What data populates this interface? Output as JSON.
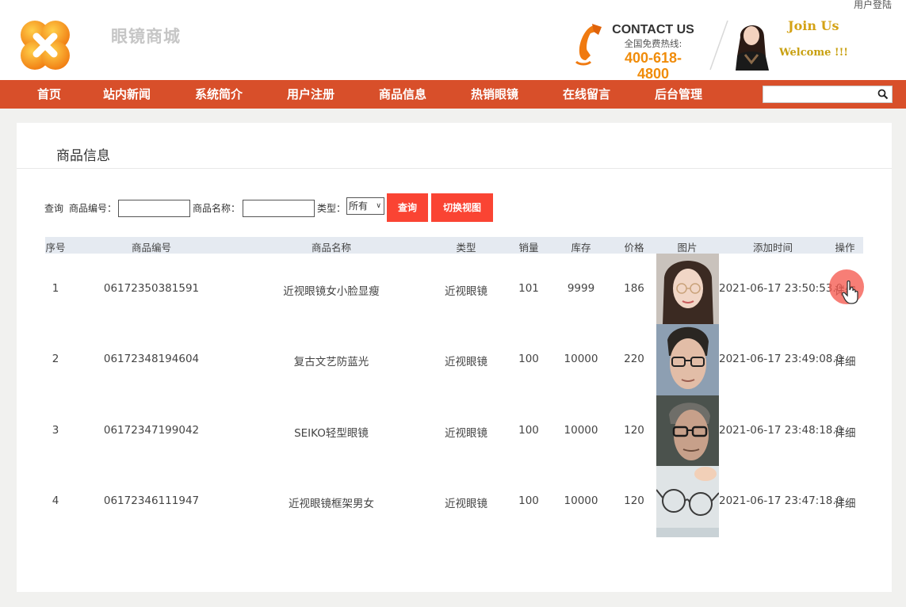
{
  "header": {
    "user_login": "用户登陆",
    "site_name": "眼镜商城",
    "contact_title": "CONTACT US",
    "contact_sub": "全国免费热线:",
    "contact_phone": "400-618-4800",
    "join": "Join Us",
    "welcome": "Welcome !!!"
  },
  "nav": {
    "items": [
      "首页",
      "站内新闻",
      "系统简介",
      "用户注册",
      "商品信息",
      "热销眼镜",
      "在线留言",
      "后台管理"
    ],
    "search_placeholder": ""
  },
  "panel": {
    "title": "商品信息"
  },
  "filter": {
    "query_label": "查询",
    "code_label": "商品编号：",
    "name_label": "商品名称：",
    "type_label": "类型：",
    "type_value": "所有",
    "query_button": "查询",
    "switch_button": "切换视图"
  },
  "table": {
    "headers": [
      "序号",
      "商品编号",
      "商品名称",
      "类型",
      "销量",
      "库存",
      "价格",
      "图片",
      "添加时间",
      "操作"
    ],
    "rows": [
      {
        "no": "1",
        "code": "06172350381591",
        "name": "近视眼镜女小脸显瘦",
        "type": "近视眼镜",
        "sales": "101",
        "stock": "9999",
        "price": "186",
        "time": "2021-06-17 23:50:53.0",
        "action": "详细"
      },
      {
        "no": "2",
        "code": "06172348194604",
        "name": "复古文艺防蓝光",
        "type": "近视眼镜",
        "sales": "100",
        "stock": "10000",
        "price": "220",
        "time": "2021-06-17 23:49:08.0",
        "action": "详细"
      },
      {
        "no": "3",
        "code": "06172347199042",
        "name": "SEIKO轻型眼镜",
        "type": "近视眼镜",
        "sales": "100",
        "stock": "10000",
        "price": "120",
        "time": "2021-06-17 23:48:18.0",
        "action": "详细"
      },
      {
        "no": "4",
        "code": "06172346111947",
        "name": "近视眼镜框架男女",
        "type": "近视眼镜",
        "sales": "100",
        "stock": "10000",
        "price": "120",
        "time": "2021-06-17 23:47:18.0",
        "action": "详细"
      }
    ]
  },
  "colors": {
    "nav_bg": "#d84f2a",
    "button_bg": "#fa4433",
    "phone_orange": "#f08c0a",
    "table_header_bg": "#e5eaf1"
  },
  "icons": [
    "logo-icon",
    "phone-icon",
    "avatar",
    "search-icon"
  ]
}
